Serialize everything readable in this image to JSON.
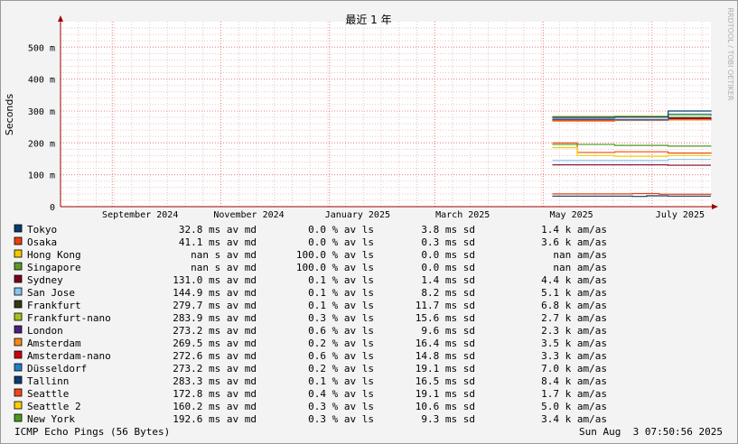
{
  "chart_data": {
    "type": "line",
    "title": "最近 1 年",
    "ylabel": "Seconds",
    "watermark": "RRDTOOL / TOBI OETIKER",
    "ylim": [
      0,
      0.58
    ],
    "y_ticks": [
      {
        "value": 0,
        "label": "0"
      },
      {
        "value": 0.1,
        "label": "100 m"
      },
      {
        "value": 0.2,
        "label": "200 m"
      },
      {
        "value": 0.3,
        "label": "300 m"
      },
      {
        "value": 0.4,
        "label": "400 m"
      },
      {
        "value": 0.5,
        "label": "500 m"
      }
    ],
    "xlim": [
      "2024-08-03",
      "2025-08-03"
    ],
    "x_ticks": [
      {
        "date": "2024-09-01",
        "label": "September 2024"
      },
      {
        "date": "2024-11-01",
        "label": "November 2024"
      },
      {
        "date": "2025-01-01",
        "label": "January 2025"
      },
      {
        "date": "2025-03-01",
        "label": "March 2025"
      },
      {
        "date": "2025-05-01",
        "label": "May 2025"
      },
      {
        "date": "2025-07-01",
        "label": "July 2025"
      }
    ],
    "grid": true,
    "legend_placement": "bottom",
    "series": [
      {
        "name": "Tokyo",
        "color": "#0a3a6e",
        "stats": [
          "32.8 ms av md",
          "0.0 % av ls",
          "3.8 ms sd",
          "1.4 k am/as"
        ],
        "points": [
          [
            "2025-05-06",
            0.033
          ],
          [
            "2025-06-20",
            0.032
          ],
          [
            "2025-06-28",
            0.034
          ],
          [
            "2025-07-10",
            0.033
          ],
          [
            "2025-08-03",
            0.033
          ]
        ]
      },
      {
        "name": "Osaka",
        "color": "#e84010",
        "stats": [
          "41.1 ms av md",
          "0.0 % av ls",
          "0.3 ms sd",
          "3.6 k am/as"
        ],
        "points": [
          [
            "2025-05-06",
            0.04
          ],
          [
            "2025-06-20",
            0.041
          ],
          [
            "2025-07-05",
            0.039
          ],
          [
            "2025-08-03",
            0.038
          ]
        ]
      },
      {
        "name": "Hong Kong",
        "color": "#f5c800",
        "stats": [
          "nan  s av md",
          "100.0 % av ls",
          "0.0 ms sd",
          "nan   am/as"
        ],
        "points": []
      },
      {
        "name": "Singapore",
        "color": "#5a9a28",
        "stats": [
          "nan  s av md",
          "100.0 % av ls",
          "0.0 ms sd",
          "nan   am/as"
        ],
        "points": []
      },
      {
        "name": "Sydney",
        "color": "#7a0020",
        "stats": [
          "131.0 ms av md",
          "0.1 % av ls",
          "1.4 ms sd",
          "4.4 k am/as"
        ],
        "points": [
          [
            "2025-05-06",
            0.131
          ],
          [
            "2025-06-05",
            0.131
          ],
          [
            "2025-07-10",
            0.13
          ],
          [
            "2025-08-03",
            0.13
          ]
        ]
      },
      {
        "name": "San Jose",
        "color": "#88c4f0",
        "stats": [
          "144.9 ms av md",
          "0.1 % av ls",
          "8.2 ms sd",
          "5.1 k am/as"
        ],
        "points": [
          [
            "2025-05-06",
            0.145
          ],
          [
            "2025-06-10",
            0.145
          ],
          [
            "2025-07-10",
            0.148
          ],
          [
            "2025-08-03",
            0.148
          ]
        ]
      },
      {
        "name": "Frankfurt",
        "color": "#2e3a10",
        "stats": [
          "279.7 ms av md",
          "0.1 % av ls",
          "11.7 ms sd",
          "6.8 k am/as"
        ],
        "points": [
          [
            "2025-05-06",
            0.28
          ],
          [
            "2025-06-10",
            0.281
          ],
          [
            "2025-07-10",
            0.279
          ],
          [
            "2025-08-03",
            0.28
          ]
        ]
      },
      {
        "name": "Frankfurt-nano",
        "color": "#a8c020",
        "stats": [
          "283.9 ms av md",
          "0.3 % av ls",
          "15.6 ms sd",
          "2.7 k am/as"
        ],
        "points": [
          [
            "2025-05-06",
            0.283
          ],
          [
            "2025-06-10",
            0.284
          ],
          [
            "2025-07-10",
            0.286
          ],
          [
            "2025-08-03",
            0.284
          ]
        ]
      },
      {
        "name": "London",
        "color": "#4a2080",
        "stats": [
          "273.2 ms av md",
          "0.6 % av ls",
          "9.6 ms sd",
          "2.3 k am/as"
        ],
        "points": [
          [
            "2025-05-06",
            0.272
          ],
          [
            "2025-06-10",
            0.273
          ],
          [
            "2025-07-10",
            0.275
          ],
          [
            "2025-08-03",
            0.274
          ]
        ]
      },
      {
        "name": "Amsterdam",
        "color": "#f08a1c",
        "stats": [
          "269.5 ms av md",
          "0.2 % av ls",
          "16.4 ms sd",
          "3.5 k am/as"
        ],
        "points": [
          [
            "2025-05-06",
            0.268
          ],
          [
            "2025-06-10",
            0.27
          ],
          [
            "2025-07-10",
            0.272
          ],
          [
            "2025-08-03",
            0.27
          ]
        ]
      },
      {
        "name": "Amsterdam-nano",
        "color": "#c80010",
        "stats": [
          "272.6 ms av md",
          "0.6 % av ls",
          "14.8 ms sd",
          "3.3 k am/as"
        ],
        "points": [
          [
            "2025-05-06",
            0.272
          ],
          [
            "2025-06-10",
            0.273
          ],
          [
            "2025-07-10",
            0.276
          ],
          [
            "2025-08-03",
            0.273
          ]
        ]
      },
      {
        "name": "Düsseldorf",
        "color": "#2080c8",
        "stats": [
          "273.2 ms av md",
          "0.2 % av ls",
          "19.1 ms sd",
          "7.0 k am/as"
        ],
        "points": [
          [
            "2025-05-06",
            0.275
          ],
          [
            "2025-06-10",
            0.272
          ],
          [
            "2025-07-10",
            0.29
          ],
          [
            "2025-08-03",
            0.285
          ]
        ]
      },
      {
        "name": "Tallinn",
        "color": "#0c3c70",
        "stats": [
          "283.3 ms av md",
          "0.1 % av ls",
          "16.5 ms sd",
          "8.4 k am/as"
        ],
        "points": [
          [
            "2025-05-06",
            0.28
          ],
          [
            "2025-06-10",
            0.281
          ],
          [
            "2025-07-10",
            0.3
          ],
          [
            "2025-08-03",
            0.298
          ]
        ]
      },
      {
        "name": "Seattle",
        "color": "#f04818",
        "stats": [
          "172.8 ms av md",
          "0.4 % av ls",
          "19.1 ms sd",
          "1.7 k am/as"
        ],
        "points": [
          [
            "2025-05-06",
            0.2
          ],
          [
            "2025-05-20",
            0.17
          ],
          [
            "2025-06-10",
            0.172
          ],
          [
            "2025-07-10",
            0.168
          ],
          [
            "2025-08-03",
            0.17
          ]
        ]
      },
      {
        "name": "Seattle 2",
        "color": "#f8d000",
        "stats": [
          "160.2 ms av md",
          "0.3 % av ls",
          "10.6 ms sd",
          "5.0 k am/as"
        ],
        "points": [
          [
            "2025-05-06",
            0.185
          ],
          [
            "2025-05-20",
            0.16
          ],
          [
            "2025-06-10",
            0.158
          ],
          [
            "2025-07-10",
            0.16
          ],
          [
            "2025-08-03",
            0.161
          ]
        ]
      },
      {
        "name": "New York",
        "color": "#4a9a1c",
        "stats": [
          "192.6 ms av md",
          "0.3 % av ls",
          "9.3 ms sd",
          "3.4 k am/as"
        ],
        "points": [
          [
            "2025-05-06",
            0.195
          ],
          [
            "2025-06-10",
            0.192
          ],
          [
            "2025-07-10",
            0.19
          ],
          [
            "2025-08-03",
            0.191
          ]
        ]
      }
    ]
  },
  "footer": {
    "left": "ICMP Echo Pings (56 Bytes)",
    "right": "Sun Aug  3 07:50:56 2025"
  }
}
